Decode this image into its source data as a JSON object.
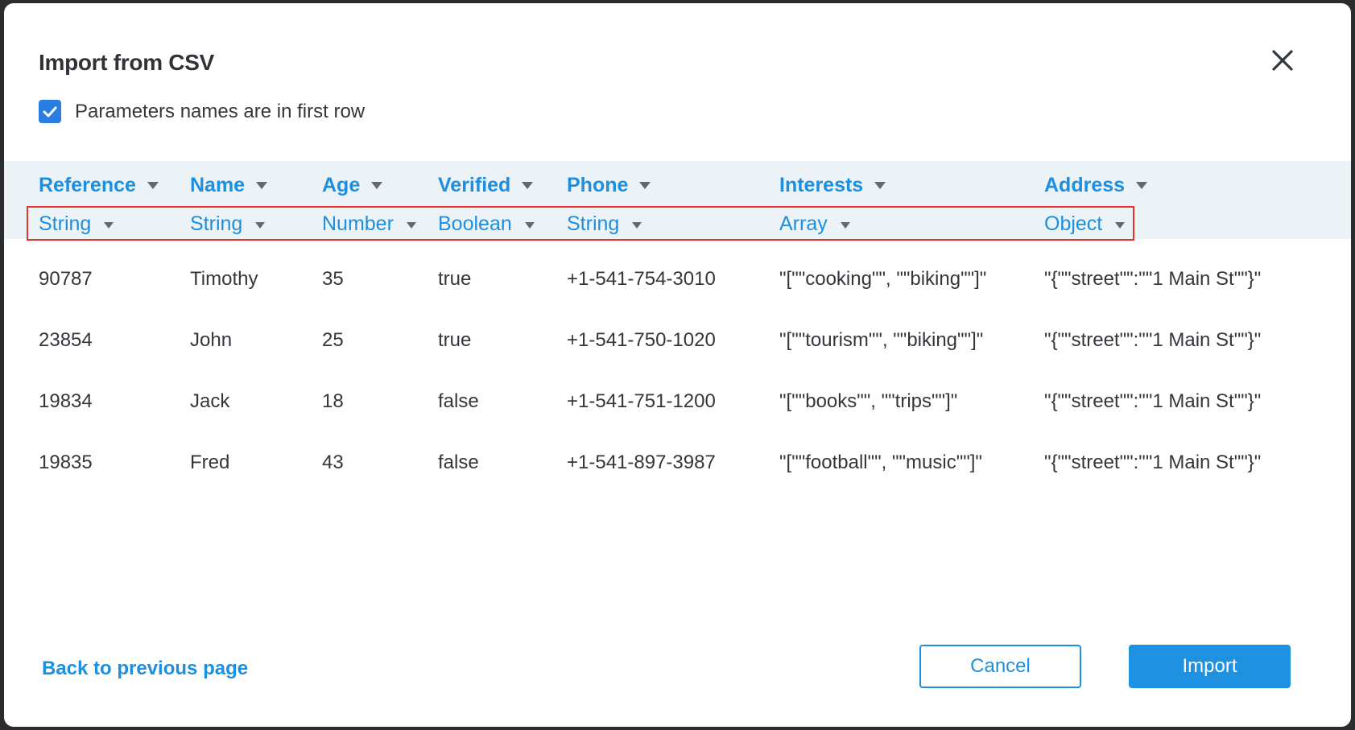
{
  "dialog": {
    "title": "Import from CSV",
    "close_icon": "close-icon",
    "checkbox": {
      "label": "Parameters names are in first row",
      "checked": true
    }
  },
  "table": {
    "columns": [
      {
        "name": "Reference",
        "type": "String"
      },
      {
        "name": "Name",
        "type": "String"
      },
      {
        "name": "Age",
        "type": "Number"
      },
      {
        "name": "Verified",
        "type": "Boolean"
      },
      {
        "name": "Phone",
        "type": "String"
      },
      {
        "name": "Interests",
        "type": "Array"
      },
      {
        "name": "Address",
        "type": "Object"
      }
    ],
    "rows": [
      [
        "90787",
        "Timothy",
        "35",
        "true",
        "+1-541-754-3010",
        "\"[\"\"cooking\"\", \"\"biking\"\"]\"",
        "\"{\"\"street\"\":\"\"1 Main St\"\"}\""
      ],
      [
        "23854",
        "John",
        "25",
        "true",
        "+1-541-750-1020",
        "\"[\"\"tourism\"\", \"\"biking\"\"]\"",
        "\"{\"\"street\"\":\"\"1 Main St\"\"}\""
      ],
      [
        "19834",
        "Jack",
        "18",
        "false",
        "+1-541-751-1200",
        "\"[\"\"books\"\", \"\"trips\"\"]\"",
        "\"{\"\"street\"\":\"\"1 Main St\"\"}\""
      ],
      [
        "19835",
        "Fred",
        "43",
        "false",
        "+1-541-897-3987",
        "\"[\"\"football\"\", \"\"music\"\"]\"",
        "\"{\"\"street\"\":\"\"1 Main St\"\"}\""
      ]
    ]
  },
  "footer": {
    "back_label": "Back to previous page",
    "cancel_label": "Cancel",
    "import_label": "Import"
  },
  "colors": {
    "accent": "#1d8fe0",
    "highlight_border": "#e8322c",
    "header_bg": "#ecf3f7",
    "text": "#33373c"
  }
}
